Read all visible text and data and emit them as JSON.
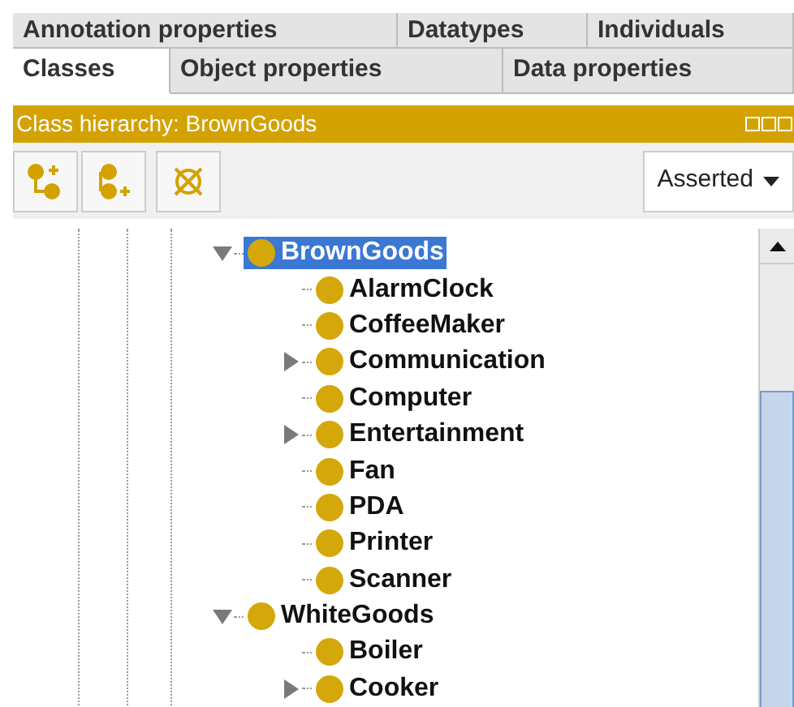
{
  "tab_rows": [
    [
      {
        "label": "Annotation properties",
        "selected": false
      },
      {
        "label": "Datatypes",
        "selected": false
      },
      {
        "label": "Individuals",
        "selected": false
      }
    ],
    [
      {
        "label": "Classes",
        "selected": true
      },
      {
        "label": "Object properties",
        "selected": false
      },
      {
        "label": "Data properties",
        "selected": false
      }
    ]
  ],
  "panel": {
    "title": "Class hierarchy: BrownGoods"
  },
  "toolbar": {
    "view_select": "Asserted"
  },
  "tree": [
    {
      "label": "BrownGoods",
      "kind": "branch",
      "expanded": true,
      "selected": true,
      "children": [
        {
          "label": "AlarmClock",
          "kind": "leaf",
          "selected": false
        },
        {
          "label": "CoffeeMaker",
          "kind": "leaf",
          "selected": false
        },
        {
          "label": "Communication",
          "kind": "branch",
          "expanded": false,
          "selected": false
        },
        {
          "label": "Computer",
          "kind": "leaf",
          "selected": false
        },
        {
          "label": "Entertainment",
          "kind": "branch",
          "expanded": false,
          "selected": false
        },
        {
          "label": "Fan",
          "kind": "leaf",
          "selected": false
        },
        {
          "label": "PDA",
          "kind": "leaf",
          "selected": false
        },
        {
          "label": "Printer",
          "kind": "leaf",
          "selected": false
        },
        {
          "label": "Scanner",
          "kind": "leaf",
          "selected": false
        }
      ]
    },
    {
      "label": "WhiteGoods",
      "kind": "branch",
      "expanded": true,
      "selected": false,
      "children": [
        {
          "label": "Boiler",
          "kind": "leaf",
          "selected": false
        },
        {
          "label": "Cooker",
          "kind": "branch",
          "expanded": false,
          "selected": false
        }
      ]
    }
  ]
}
